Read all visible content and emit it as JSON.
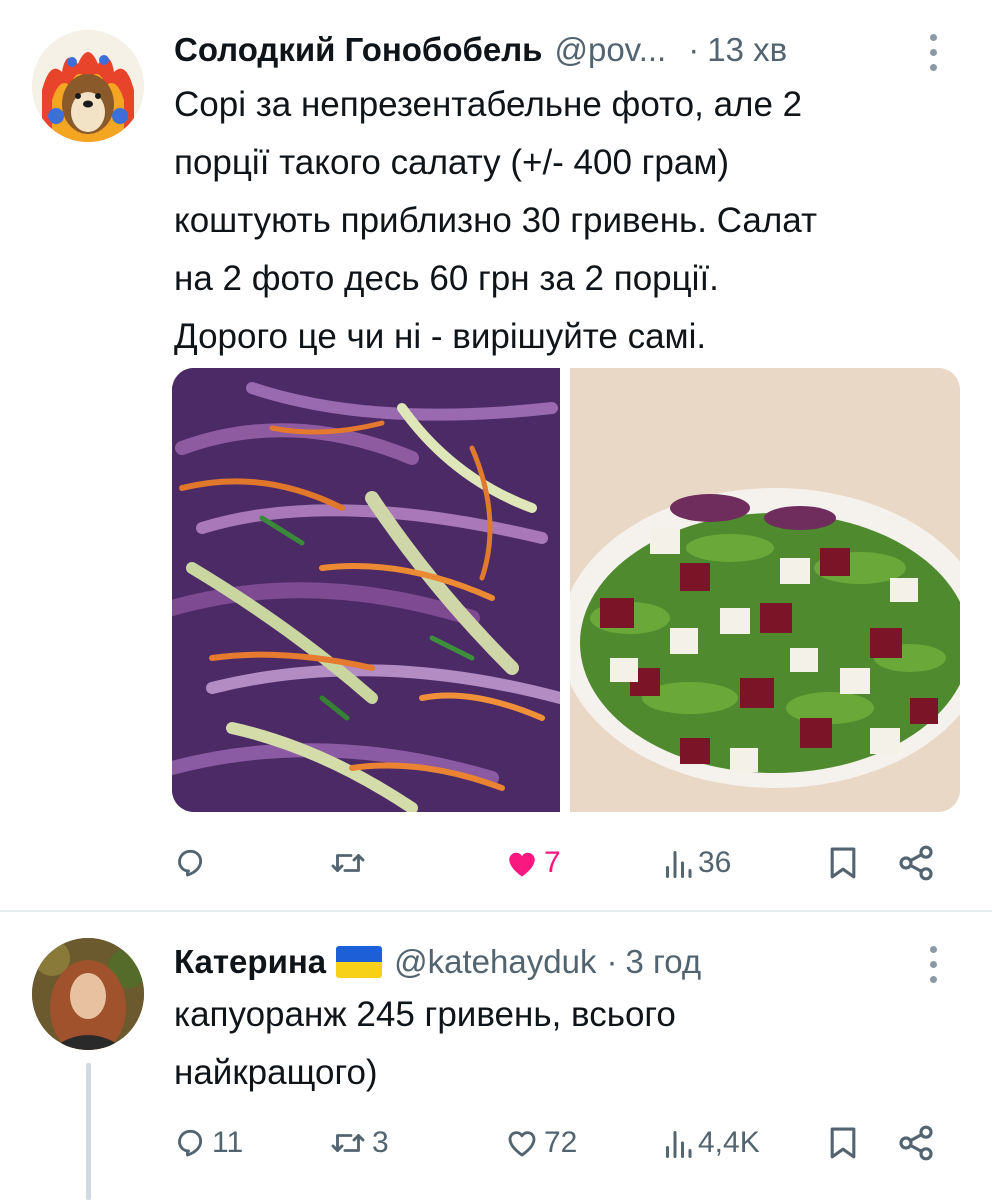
{
  "tweets": [
    {
      "author_name": "Солодкий Гонобобель",
      "handle": "@pov...",
      "separator": "·",
      "time": "13 хв",
      "text": "Сорі за непрезентабельне фото, але 2\nпорції такого салату (+/- 400 грам)\nкоштують приблизно 30 гривень. Салат\nна 2 фото десь 60 грн за 2 порції.\nДорого це чи ні - вирішуйте самі.",
      "images": [
        "red-cabbage-carrot-salad-photo",
        "beet-feta-arugula-salad-photo"
      ],
      "actions": {
        "reply": {
          "icon": "reply-icon",
          "count": ""
        },
        "retweet": {
          "icon": "retweet-icon",
          "count": ""
        },
        "like": {
          "icon": "heart-filled-icon",
          "count": "7",
          "liked": true
        },
        "views": {
          "icon": "views-icon",
          "count": "36"
        },
        "bookmark": {
          "icon": "bookmark-icon"
        },
        "share": {
          "icon": "share-icon"
        }
      }
    },
    {
      "author_name": "Катерина",
      "flag": "ukraine-flag-emoji",
      "handle": "@katehayduk",
      "separator": "·",
      "time": "3 год",
      "text": "капуоранж 245 гривень, всього\nнайкращого)",
      "actions": {
        "reply": {
          "icon": "reply-icon",
          "count": "11"
        },
        "retweet": {
          "icon": "retweet-icon",
          "count": "3"
        },
        "like": {
          "icon": "heart-outline-icon",
          "count": "72",
          "liked": false
        },
        "views": {
          "icon": "views-icon",
          "count": "4,4K"
        },
        "bookmark": {
          "icon": "bookmark-icon"
        },
        "share": {
          "icon": "share-icon"
        }
      }
    }
  ],
  "colors": {
    "text_primary": "#0f1419",
    "text_secondary": "#536471",
    "like_active": "#f91880",
    "divider": "#e7ecef",
    "thread_line": "#cfd9de",
    "flag_blue": "#1d5fd6",
    "flag_yellow": "#f7d117"
  }
}
